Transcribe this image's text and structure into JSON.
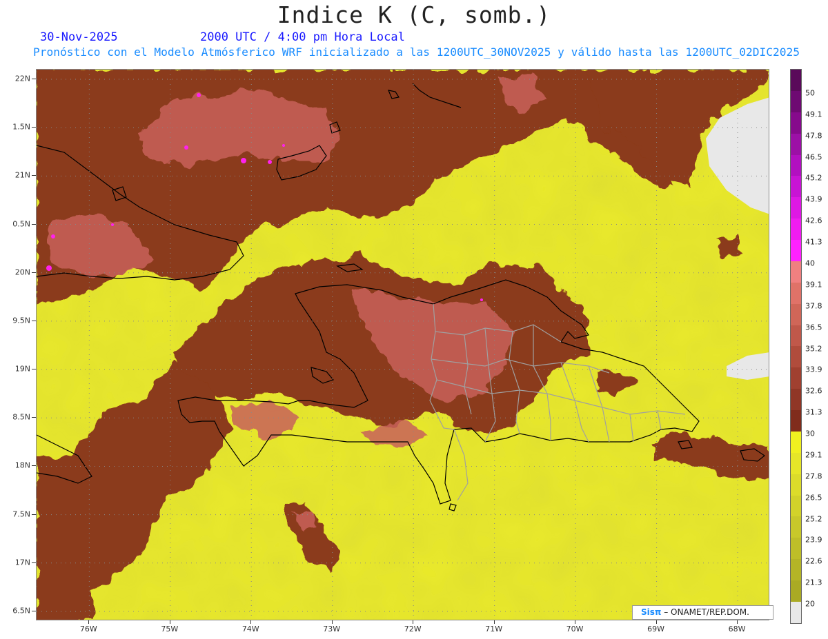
{
  "header": {
    "title": "Indice K (C, somb.)",
    "date": "30-Nov-2025",
    "time": "2000 UTC / 4:00 pm Hora Local",
    "subtitle": "Pronóstico con el Modelo Atmósferico WRF inicializado a las 1200UTC_30NOV2025 y válido hasta las  1200UTC_02DIC2025"
  },
  "map": {
    "lat_labels": [
      "22N",
      "1.5N",
      "21N",
      "0.5N",
      "20N",
      "9.5N",
      "19N",
      "8.5N",
      "18N",
      "7.5N",
      "17N",
      "6.5N"
    ],
    "lat_values": [
      22,
      21.5,
      21,
      20.5,
      20,
      19.5,
      19,
      18.5,
      18,
      17.5,
      17,
      16.5
    ],
    "lon_labels": [
      "76W",
      "75W",
      "74W",
      "73W",
      "72W",
      "71W",
      "70W",
      "69W",
      "68W"
    ],
    "lon_values": [
      -76,
      -75,
      -74,
      -73,
      -72,
      -71,
      -70,
      -69,
      -68
    ],
    "lon_range": [
      -76.65,
      -67.6
    ],
    "lat_range": [
      16.4,
      22.1
    ],
    "grid": true,
    "field_colors": {
      "low": "#eaea2a",
      "moderate": "#8b3a1a",
      "high": "#c8605a",
      "extreme": "#ff22ee",
      "missing": "#e8e8e8"
    },
    "coastline_color": "#000000",
    "province_border_color": "#a0a0a0"
  },
  "colorbar": {
    "labels": [
      "50",
      "49.1",
      "47.8",
      "46.5",
      "45.2",
      "43.9",
      "42.6",
      "41.3",
      "40",
      "39.1",
      "37.8",
      "36.5",
      "35.2",
      "33.9",
      "32.6",
      "31.3",
      "30",
      "29.1",
      "27.8",
      "26.5",
      "25.2",
      "23.9",
      "22.6",
      "21.3",
      "20"
    ],
    "colors": [
      "#5a0a5a",
      "#6e0a72",
      "#860a8c",
      "#9c10a6",
      "#b210c0",
      "#c814d4",
      "#de18e4",
      "#f01cf0",
      "#ff22ff",
      "#f08080",
      "#e07268",
      "#d06658",
      "#c0584a",
      "#b04c3c",
      "#a04030",
      "#903626",
      "#802c1c",
      "#f0f020",
      "#e6e628",
      "#dcdc2a",
      "#d2d22a",
      "#c8c82a",
      "#bebe28",
      "#b4b426",
      "#aaaa24",
      "#e8e8e8"
    ]
  },
  "credit": {
    "logo": "Sisπ",
    "text": "– ONAMET/REP.DOM."
  }
}
